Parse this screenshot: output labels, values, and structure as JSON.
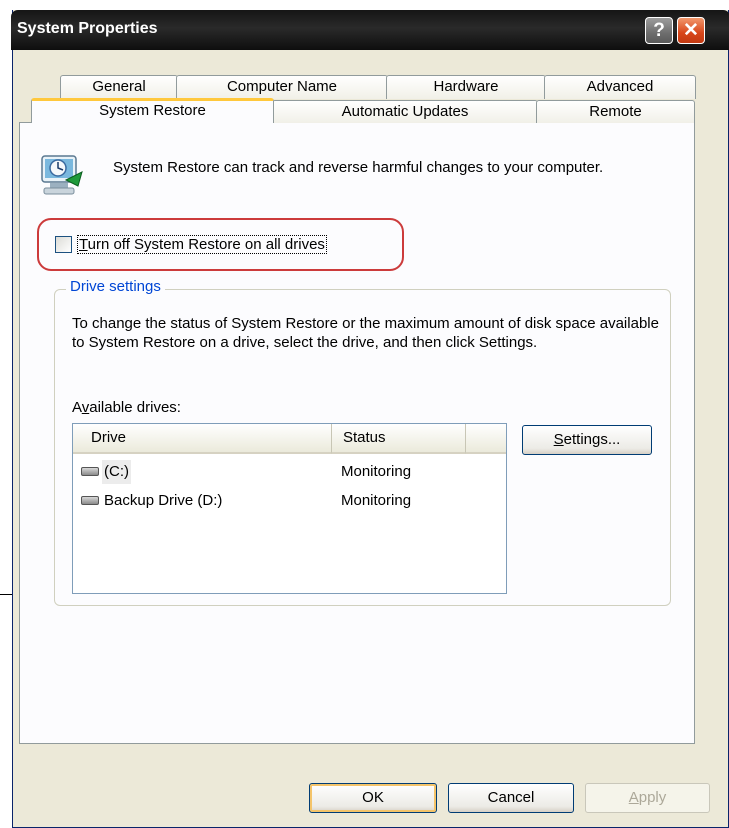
{
  "window": {
    "title": "System Properties"
  },
  "titlebar": {
    "help_glyph": "?",
    "close_glyph": "✕"
  },
  "tabs": {
    "row1": [
      "General",
      "Computer Name",
      "Hardware",
      "Advanced"
    ],
    "row2": [
      "System Restore",
      "Automatic Updates",
      "Remote"
    ],
    "active": "System Restore"
  },
  "system_restore": {
    "icon": "system-restore-icon",
    "intro_text": "System Restore can track and reverse harmful changes to your computer.",
    "turn_off": {
      "label_pre": "",
      "label_accel": "T",
      "label_post": "urn off System Restore on all drives",
      "checked": false
    }
  },
  "drive_settings": {
    "group_title": "Drive settings",
    "description": "To change the status of System Restore or the maximum amount of disk space available to System Restore on a drive, select the drive, and then click Settings.",
    "available_pre": "A",
    "available_accel": "v",
    "available_post": "ailable drives:",
    "columns": [
      "Drive",
      "Status"
    ],
    "drives": [
      {
        "name": "(C:)",
        "status": "Monitoring",
        "icon": "hard-drive-icon"
      },
      {
        "name": "Backup Drive (D:)",
        "status": "Monitoring",
        "icon": "hard-drive-icon"
      }
    ],
    "settings_accel": "S",
    "settings_post": "ettings..."
  },
  "footer": {
    "ok_label": "OK",
    "cancel_label": "Cancel",
    "apply_accel": "A",
    "apply_post": "pply"
  },
  "colors": {
    "highlight": "#cc3b3b",
    "group_title": "#0046d5",
    "active_tab_top": "#ffc83c"
  }
}
